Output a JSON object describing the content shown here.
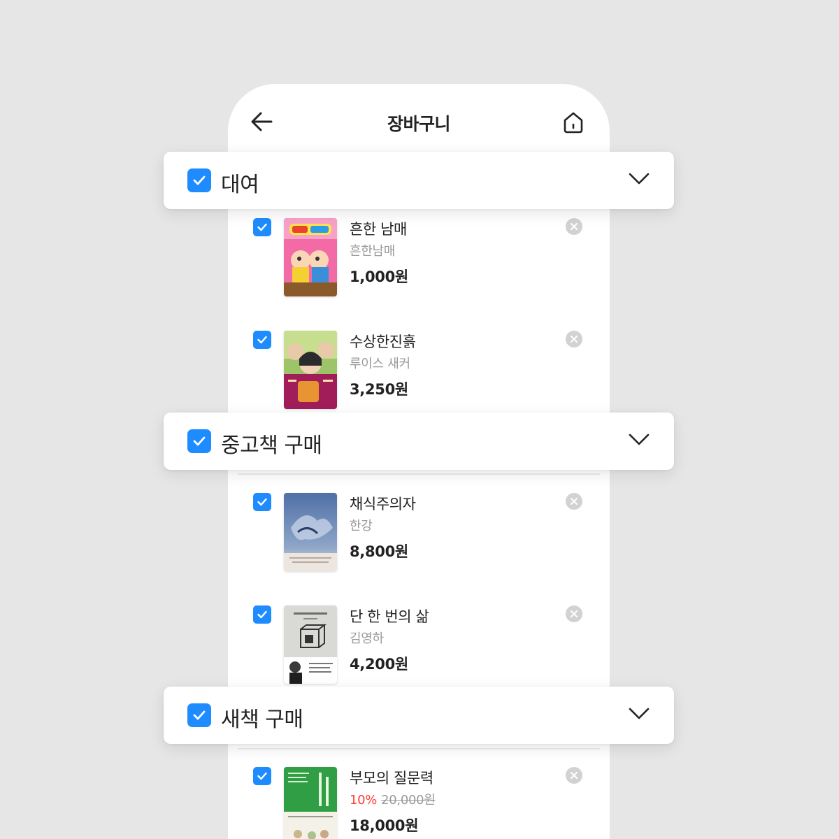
{
  "header": {
    "title": "장바구니",
    "back_icon": "arrow-left-icon",
    "home_icon": "home-icon"
  },
  "colors": {
    "accent": "#1e8cff",
    "discount": "#ff3b30",
    "background": "#e6e6e6"
  },
  "sections": [
    {
      "title": "대여",
      "checked": true,
      "items": [
        {
          "title": "흔한 남매",
          "author": "흔한남매",
          "price": "1,000원",
          "checked": true
        },
        {
          "title": "수상한진흙",
          "author": "루이스 새커",
          "price": "3,250원",
          "checked": true
        }
      ]
    },
    {
      "title": "중고책 구매",
      "checked": true,
      "items": [
        {
          "title": "채식주의자",
          "author": "한강",
          "price": "8,800원",
          "checked": true
        },
        {
          "title": "단 한 번의 삶",
          "author": "김영하",
          "price": "4,200원",
          "checked": true
        }
      ]
    },
    {
      "title": "새책 구매",
      "checked": true,
      "items": [
        {
          "title": "부모의 질문력",
          "discount": "10%",
          "original_price": "20,000원",
          "price": "18,000원",
          "checked": true
        }
      ]
    }
  ]
}
